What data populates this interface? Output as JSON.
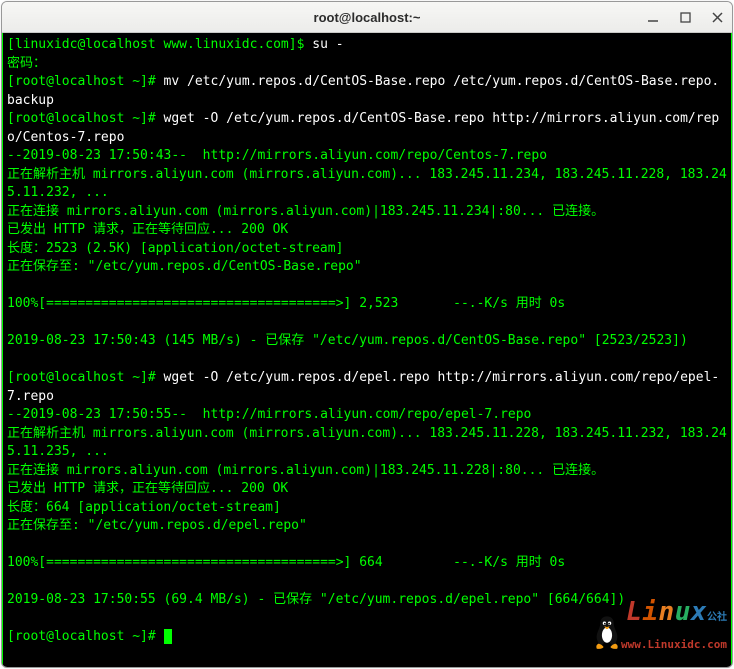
{
  "window": {
    "title": "root@localhost:~"
  },
  "term": {
    "l1a": "[linuxidc@localhost www.linuxidc.com]$ ",
    "l1b": "su -",
    "l2": "密码：",
    "l3a": "[root@localhost ~]# ",
    "l3b": "mv /etc/yum.repos.d/CentOS-Base.repo /etc/yum.repos.d/CentOS-Base.repo.backup",
    "l4a": "[root@localhost ~]# ",
    "l4b": "wget -O /etc/yum.repos.d/CentOS-Base.repo http://mirrors.aliyun.com/repo/Centos-7.repo",
    "l5": "--2019-08-23 17:50:43--  http://mirrors.aliyun.com/repo/Centos-7.repo",
    "l6": "正在解析主机 mirrors.aliyun.com (mirrors.aliyun.com)... 183.245.11.234, 183.245.11.228, 183.245.11.232, ...",
    "l7": "正在连接 mirrors.aliyun.com (mirrors.aliyun.com)|183.245.11.234|:80... 已连接。",
    "l8": "已发出 HTTP 请求，正在等待回应... 200 OK",
    "l9": "长度：2523 (2.5K) [application/octet-stream]",
    "l10": "正在保存至: \"/etc/yum.repos.d/CentOS-Base.repo\"",
    "blank1": "",
    "l11": "100%[=====================================>] 2,523       --.-K/s 用时 0s",
    "blank2": "",
    "l12": "2019-08-23 17:50:43 (145 MB/s) - 已保存 \"/etc/yum.repos.d/CentOS-Base.repo\" [2523/2523])",
    "blank3": "",
    "l13a": "[root@localhost ~]# ",
    "l13b": "wget -O /etc/yum.repos.d/epel.repo http://mirrors.aliyun.com/repo/epel-7.repo",
    "l14": "--2019-08-23 17:50:55--  http://mirrors.aliyun.com/repo/epel-7.repo",
    "l15": "正在解析主机 mirrors.aliyun.com (mirrors.aliyun.com)... 183.245.11.228, 183.245.11.232, 183.245.11.235, ...",
    "l16": "正在连接 mirrors.aliyun.com (mirrors.aliyun.com)|183.245.11.228|:80... 已连接。",
    "l17": "已发出 HTTP 请求，正在等待回应... 200 OK",
    "l18": "长度：664 [application/octet-stream]",
    "l19": "正在保存至: \"/etc/yum.repos.d/epel.repo\"",
    "blank4": "",
    "l20": "100%[=====================================>] 664         --.-K/s 用时 0s",
    "blank5": "",
    "l21": "2019-08-23 17:50:55 (69.4 MB/s) - 已保存 \"/etc/yum.repos.d/epel.repo\" [664/664])",
    "blank6": "",
    "l22": "[root@localhost ~]# "
  },
  "logo": {
    "text": "Linux",
    "sub": "公社",
    "url": "www.Linuxidc.com"
  }
}
